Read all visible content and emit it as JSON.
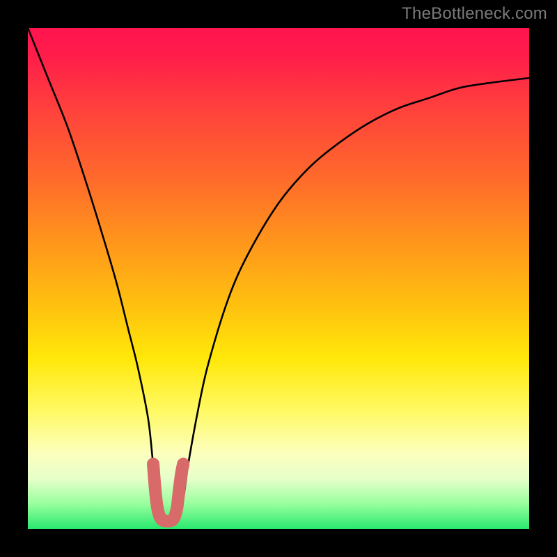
{
  "watermark": {
    "text": "TheBottleneck.com"
  },
  "chart_data": {
    "type": "line",
    "title": "",
    "xlabel": "",
    "ylabel": "",
    "ylim": [
      0,
      100
    ],
    "xlim": [
      0,
      100
    ],
    "series": [
      {
        "name": "bottleneck-curve",
        "x": [
          0,
          4,
          8,
          12,
          16,
          18,
          20,
          22,
          24,
          25,
          26,
          27,
          28,
          29,
          30,
          31,
          32,
          34,
          36,
          40,
          44,
          50,
          56,
          62,
          68,
          74,
          80,
          86,
          92,
          100
        ],
        "values": [
          100,
          90,
          80,
          68,
          55,
          48,
          40,
          32,
          22,
          13,
          6,
          3,
          2,
          2,
          3,
          6,
          13,
          24,
          33,
          46,
          55,
          65,
          72,
          77,
          81,
          84,
          86,
          88,
          89,
          90
        ]
      },
      {
        "name": "optimal-marker",
        "x": [
          25.0,
          25.4,
          25.8,
          26.2,
          26.6,
          27.0,
          27.4,
          27.8,
          28.2,
          28.6,
          29.0,
          29.4,
          29.8,
          30.2,
          30.6,
          31.0
        ],
        "values": [
          13.0,
          8.0,
          4.5,
          2.8,
          2.0,
          1.7,
          1.6,
          1.6,
          1.6,
          1.7,
          2.0,
          2.8,
          4.5,
          8.0,
          11.0,
          13.0
        ]
      }
    ],
    "background_gradient": {
      "top": "#ff1450",
      "middle": "#ffe80a",
      "bottom": "#28e86e"
    }
  }
}
